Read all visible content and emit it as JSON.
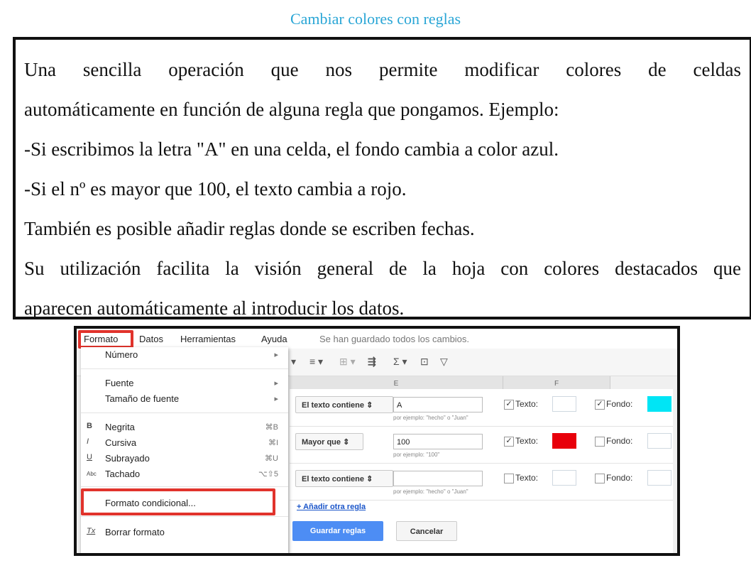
{
  "slide": {
    "title": "Cambiar colores con reglas",
    "lines": [
      "Una sencilla operación que nos permite modificar colores de celdas",
      "automáticamente en función de alguna regla que pongamos. Ejemplo:",
      "-Si escribimos la letra \"A\" en una celda, el fondo cambia a color azul.",
      "-Si el nº es mayor que 100, el texto cambia a rojo.",
      "También es posible añadir reglas donde se escriben fechas.",
      "Su utilización facilita la visión general de la hoja con colores destacados que",
      "aparecen automáticamente al introducir los datos."
    ]
  },
  "menubar": {
    "formato": "Formato",
    "datos": "Datos",
    "herramientas": "Herramientas",
    "ayuda": "Ayuda",
    "saved_status": "Se han guardado todos los cambios."
  },
  "columns": {
    "e": "E",
    "f": "F"
  },
  "format_menu": {
    "numero": "Número",
    "fuente": "Fuente",
    "tamano": "Tamaño de fuente",
    "negrita": "Negrita",
    "negrita_sc": "⌘B",
    "cursiva": "Cursiva",
    "cursiva_sc": "⌘I",
    "subrayado": "Subrayado",
    "subrayado_sc": "⌘U",
    "tachado": "Tachado",
    "tachado_sc": "⌥⇧5",
    "condicional": "Formato condicional...",
    "borrar": "Borrar formato",
    "icons": {
      "bold": "B",
      "italic": "I",
      "underline": "U",
      "strike": "Abc",
      "clear": "Tx"
    }
  },
  "rules": [
    {
      "condition": "El texto contiene",
      "value": "A",
      "hint": "por ejemplo: \"hecho\" o \"Juan\"",
      "texto_label": "Texto:",
      "fondo_label": "Fondo:",
      "texto_checked": true,
      "fondo_checked": true,
      "texto_color": "#ffffff",
      "fondo_color": "#00e5f5"
    },
    {
      "condition": "Mayor que",
      "value": "100",
      "hint": "por ejemplo: \"100\"",
      "texto_label": "Texto:",
      "fondo_label": "Fondo:",
      "texto_checked": true,
      "fondo_checked": false,
      "texto_color": "#e8000b",
      "fondo_color": "#ffffff"
    },
    {
      "condition": "El texto contiene",
      "value": "",
      "hint": "por ejemplo: \"hecho\" o \"Juan\"",
      "texto_label": "Texto:",
      "fondo_label": "Fondo:",
      "texto_checked": false,
      "fondo_checked": false,
      "texto_color": "#ffffff",
      "fondo_color": "#ffffff"
    }
  ],
  "panel": {
    "add_rule": "+ Añadir otra regla",
    "save": "Guardar reglas",
    "cancel": "Cancelar"
  },
  "colors": {
    "highlight": "#e1332c",
    "title": "#2aa6d6",
    "primary": "#4d8df4"
  }
}
